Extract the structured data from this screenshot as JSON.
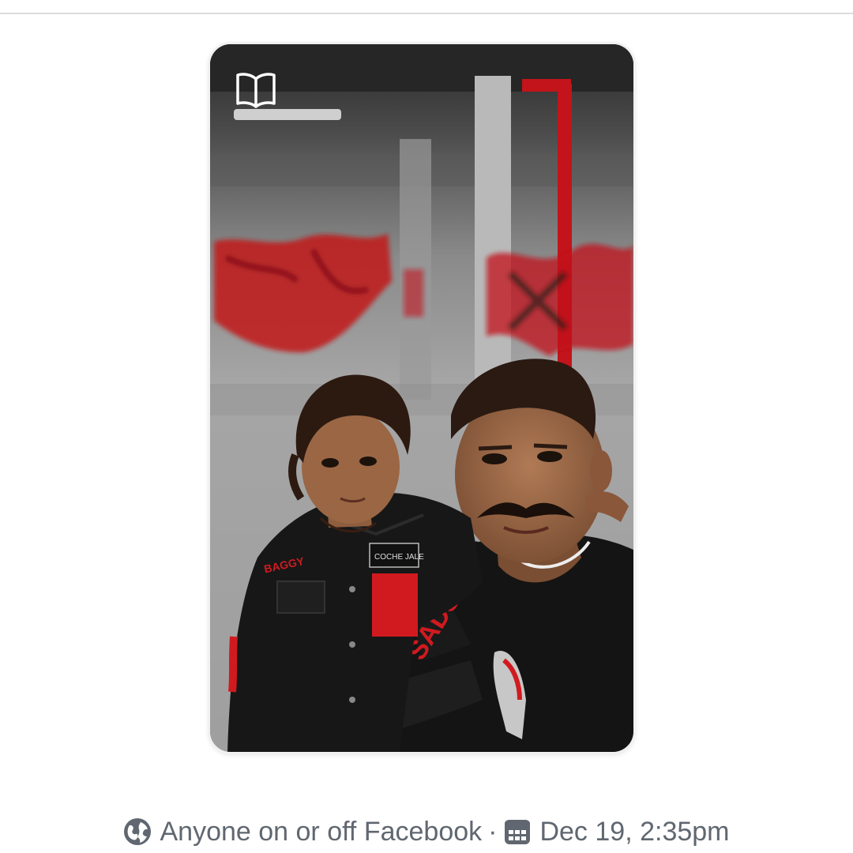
{
  "post": {
    "audience_label": "Anyone on or off Facebook",
    "separator": "·",
    "timestamp": "Dec 19, 2:35pm"
  },
  "icons": {
    "story_badge": "open-book-icon",
    "audience": "globe-icon",
    "date": "calendar-icon"
  },
  "photo": {
    "description_icon_color": "#ffffff",
    "accent_color": "#d11a1f"
  }
}
